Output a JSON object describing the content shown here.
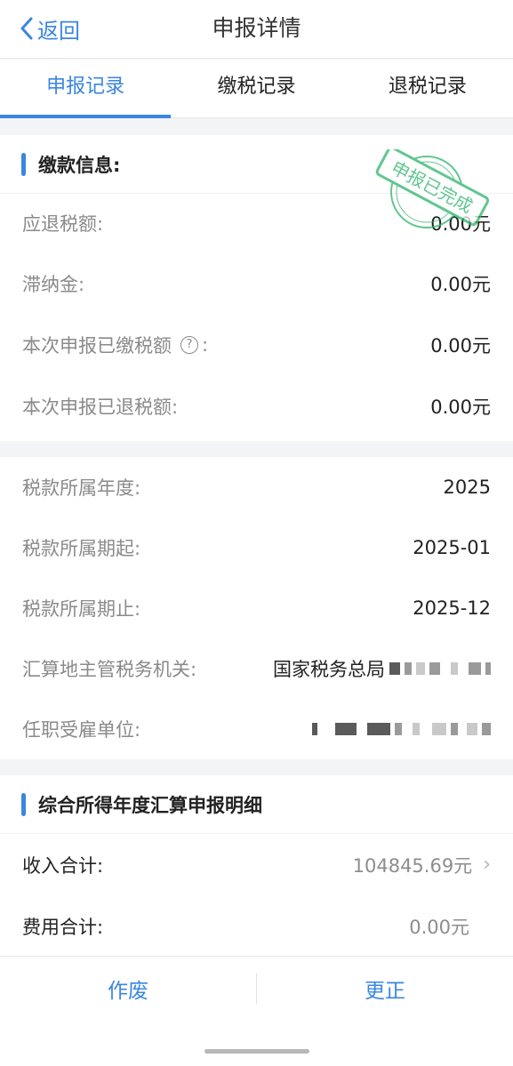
{
  "header": {
    "back_label": "返回",
    "title": "申报详情"
  },
  "tabs": [
    {
      "label": "申报记录",
      "active": true
    },
    {
      "label": "缴税记录",
      "active": false
    },
    {
      "label": "退税记录",
      "active": false
    }
  ],
  "payment": {
    "section_title": "缴款信息:",
    "stamp_text": "申报已完成",
    "rows": [
      {
        "label": "应退税额:",
        "value": "0.00元"
      },
      {
        "label": "滞纳金:",
        "value": "0.00元"
      },
      {
        "label": "本次申报已缴税额",
        "help": true,
        "colon": ":",
        "value": "0.00元"
      },
      {
        "label": "本次申报已退税额:",
        "value": "0.00元"
      }
    ]
  },
  "period": {
    "rows": [
      {
        "label": "税款所属年度:",
        "value": "2025"
      },
      {
        "label": "税款所属期起:",
        "value": "2025-01"
      },
      {
        "label": "税款所属期止:",
        "value": "2025-12"
      },
      {
        "label": "汇算地主管税务机关:",
        "value": "国家税务总局"
      },
      {
        "label": "任职受雇单位:",
        "value": ""
      }
    ]
  },
  "detail": {
    "section_title": "综合所得年度汇算申报明细",
    "rows": [
      {
        "label": "收入合计:",
        "value": "104845.69元",
        "has_chevron": true
      },
      {
        "label": "费用合计:",
        "value": "0.00元",
        "has_chevron": false
      }
    ]
  },
  "footer": {
    "void_label": "作废",
    "correct_label": "更正"
  },
  "colors": {
    "accent": "#3a86e0",
    "stamp": "#2eb36b"
  },
  "icons": {
    "back": "chevron-left-icon",
    "help": "question-circle-icon",
    "chevron": "chevron-right-icon"
  }
}
